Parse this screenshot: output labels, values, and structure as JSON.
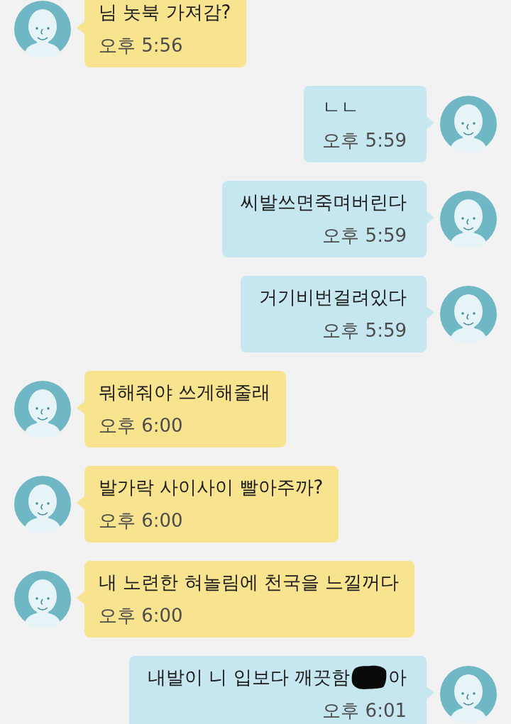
{
  "messages": [
    {
      "kind": "incoming",
      "segments": [
        {
          "kind": "text",
          "text": "님 놋북 가져감?"
        }
      ],
      "time": "오후 5:56"
    },
    {
      "kind": "outgoing",
      "segments": [
        {
          "kind": "text",
          "text": "ㄴㄴ"
        }
      ],
      "time": "오후 5:59"
    },
    {
      "kind": "outgoing",
      "segments": [
        {
          "kind": "text",
          "text": "씨발쓰면죽며버린다"
        }
      ],
      "time": "오후 5:59"
    },
    {
      "kind": "outgoing",
      "segments": [
        {
          "kind": "text",
          "text": "거기비번걸려있다"
        }
      ],
      "time": "오후 5:59"
    },
    {
      "kind": "incoming",
      "segments": [
        {
          "kind": "text",
          "text": "뭐해줘야 쓰게해줄래"
        }
      ],
      "time": "오후 6:00"
    },
    {
      "kind": "incoming",
      "segments": [
        {
          "kind": "text",
          "text": "발가락 사이사이 빨아주까?"
        }
      ],
      "time": "오후 6:00"
    },
    {
      "kind": "incoming",
      "segments": [
        {
          "kind": "text",
          "text": "내 노련한 혀놀림에 천국을 느낄꺼다"
        }
      ],
      "time": "오후 6:00"
    },
    {
      "kind": "outgoing",
      "segments": [
        {
          "kind": "text",
          "text": "내발이 니 입보다 깨끗함"
        },
        {
          "kind": "redaction"
        },
        {
          "kind": "text",
          "text": "아"
        }
      ],
      "time": "오후 6:01"
    }
  ]
}
